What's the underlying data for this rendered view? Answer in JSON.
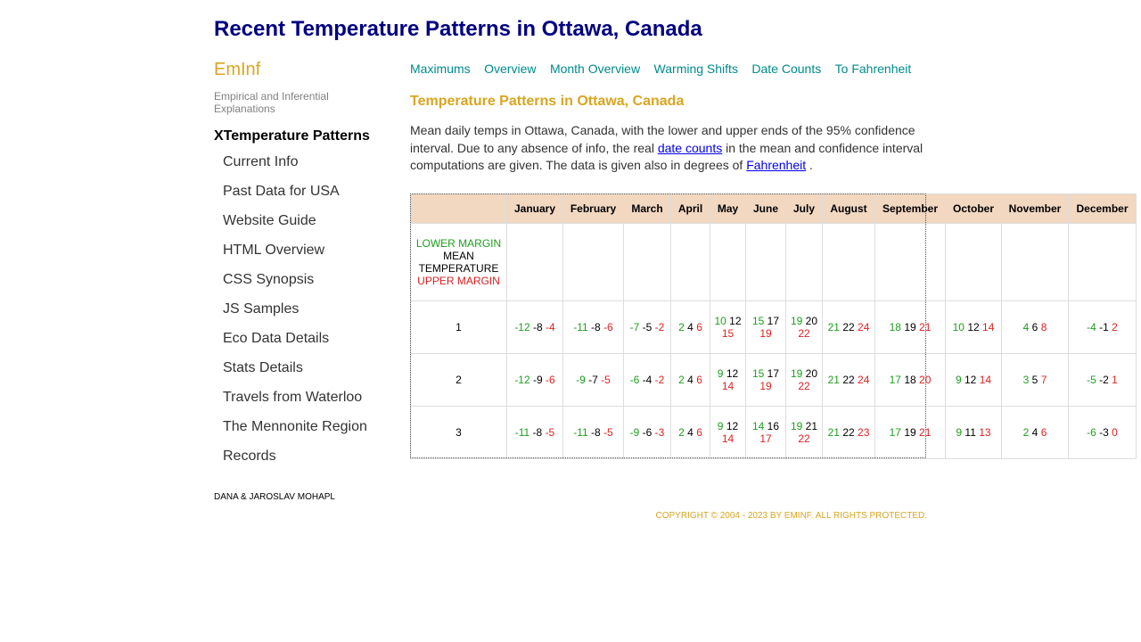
{
  "header": {
    "title": "Recent Temperature Patterns in Ottawa, Canada"
  },
  "sidebar": {
    "brand": "EmInf",
    "tagline": "Empirical and Inferential Explanations",
    "section_title": "XTemperature Patterns",
    "items": [
      "Current Info",
      "Past Data for USA",
      "Website Guide",
      "HTML Overview",
      "CSS Synopsis",
      "JS Samples",
      "Eco Data Details",
      "Stats Details",
      "Travels from Waterloo",
      "The Mennonite Region",
      "Records"
    ]
  },
  "nav": {
    "links": [
      "Maximums",
      "Overview",
      "Month Overview",
      "Warming Shifts",
      "Date Counts",
      "To Fahrenheit"
    ]
  },
  "main": {
    "section_title": "Temperature Patterns in Ottawa, Canada",
    "desc_part1": "Mean daily temps in Ottawa, Canada, with the lower and upper ends of the 95% confidence interval. Due to any absence of info, the real ",
    "desc_link1": "date counts",
    "desc_part2": " in the mean and confidence interval computations are given. The data is given also in degrees of ",
    "desc_link2": "Fahrenheit",
    "desc_part3": " ."
  },
  "table": {
    "months": [
      "January",
      "February",
      "March",
      "April",
      "May",
      "June",
      "July",
      "August",
      "September",
      "October",
      "November",
      "December"
    ],
    "legend": {
      "lower": "LOWER MARGIN",
      "mean": "MEAN TEMPERATURE",
      "upper": "UPPER MARGIN"
    },
    "rows": [
      {
        "day": "1",
        "cells": [
          [
            "-12",
            "-8",
            "-4"
          ],
          [
            "-11",
            "-8",
            "-6"
          ],
          [
            "-7",
            "-5",
            "-2"
          ],
          [
            "2",
            "4",
            "6"
          ],
          [
            "10",
            "12",
            "15"
          ],
          [
            "15",
            "17",
            "19"
          ],
          [
            "19",
            "20",
            "22"
          ],
          [
            "21",
            "22",
            "24"
          ],
          [
            "18",
            "19",
            "21"
          ],
          [
            "10",
            "12",
            "14"
          ],
          [
            "4",
            "6",
            "8"
          ],
          [
            "-4",
            "-1",
            "2"
          ]
        ]
      },
      {
        "day": "2",
        "cells": [
          [
            "-12",
            "-9",
            "-6"
          ],
          [
            "-9",
            "-7",
            "-5"
          ],
          [
            "-6",
            "-4",
            "-2"
          ],
          [
            "2",
            "4",
            "6"
          ],
          [
            "9",
            "12",
            "14"
          ],
          [
            "15",
            "17",
            "19"
          ],
          [
            "19",
            "20",
            "22"
          ],
          [
            "21",
            "22",
            "24"
          ],
          [
            "17",
            "18",
            "20"
          ],
          [
            "9",
            "12",
            "14"
          ],
          [
            "3",
            "5",
            "7"
          ],
          [
            "-5",
            "-2",
            "1"
          ]
        ]
      },
      {
        "day": "3",
        "cells": [
          [
            "-11",
            "-8",
            "-5"
          ],
          [
            "-11",
            "-8",
            "-5"
          ],
          [
            "-9",
            "-6",
            "-3"
          ],
          [
            "2",
            "4",
            "6"
          ],
          [
            "9",
            "12",
            "14"
          ],
          [
            "14",
            "16",
            "17"
          ],
          [
            "19",
            "21",
            "22"
          ],
          [
            "21",
            "22",
            "23"
          ],
          [
            "17",
            "19",
            "21"
          ],
          [
            "9",
            "11",
            "13"
          ],
          [
            "2",
            "4",
            "6"
          ],
          [
            "-6",
            "-3",
            "0"
          ]
        ]
      }
    ]
  },
  "footer": {
    "author": "DANA & JAROSLAV MOHAPL",
    "copyright": "COPYRIGHT © 2004 - 2023 BY EMINF. ALL RIGHTS PROTECTED."
  },
  "colors": {
    "title": "#000080",
    "brand": "#DAA520",
    "nav_link": "#008B8B",
    "header_bg": "#F2D7C1",
    "lower_margin": "#1E9E1E",
    "upper_margin": "#DD2222"
  }
}
